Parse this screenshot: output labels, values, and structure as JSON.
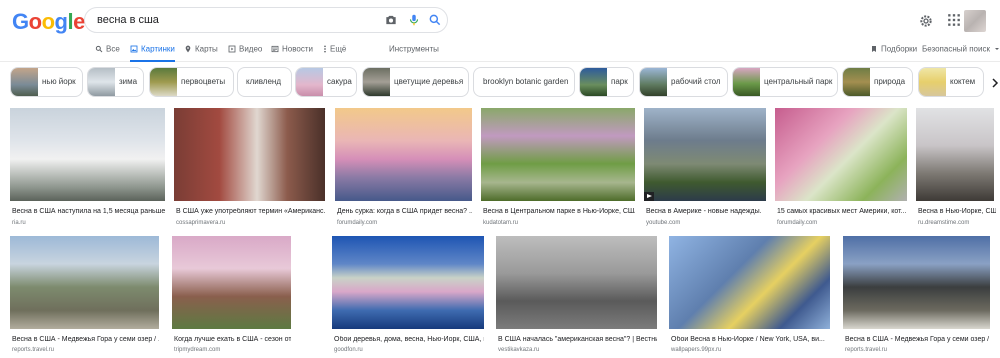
{
  "logo": "Google",
  "search": {
    "query": "весна в сша"
  },
  "tabs": {
    "all": "Все",
    "images": "Картинки",
    "maps": "Карты",
    "video": "Видео",
    "news": "Новости",
    "more": "Ещё",
    "tools": "Инструменты",
    "collections": "Подборки",
    "safesearch": "Безопасный поиск"
  },
  "chips": [
    "нью йорк",
    "зима",
    "первоцветы",
    "кливленд",
    "сакура",
    "цветущие деревья",
    "brooklyn botanic garden",
    "парк",
    "рабочий стол",
    "центральный парк",
    "природа",
    "коктем"
  ],
  "row1": [
    {
      "caption": "Весна в США наступила на 1,5 месяца раньше ...",
      "source": "ria.ru"
    },
    {
      "caption": "В США уже употребляют термин «Американс...",
      "source": "cossaprimavera.ru"
    },
    {
      "caption": "День сурка: когда в США придет весна? ...",
      "source": "forumdaily.com"
    },
    {
      "caption": "Весна в Центральном парке в Нью-Йорке, США.",
      "source": "kudatotam.ru"
    },
    {
      "caption": "Весна в Америке - новые надежды.",
      "source": "youtube.com"
    },
    {
      "caption": "15 самых красивых мест Америки, кот...",
      "source": "forumdaily.com"
    },
    {
      "caption": "Весна в Нью-Йорке, США.",
      "source": "ru.dreamstime.com"
    }
  ],
  "row2": [
    {
      "caption": "Весна в США - Медвежья Гора у семи озер / ...",
      "source": "reports.travel.ru"
    },
    {
      "caption": "Когда лучше ехать в США - сезон отдыха в США ...",
      "source": "tripmydream.com"
    },
    {
      "caption": "Обои деревья, дома, весна, Нью-Йорк, США, во...",
      "source": "goodfon.ru"
    },
    {
      "caption": "В США началась \"американская весна\"? | Вестник...",
      "source": "vestikavkaza.ru"
    },
    {
      "caption": "Обои Весна в Нью-Йорке / New York, USA, ви...",
      "source": "wallpapers.99px.ru"
    },
    {
      "caption": "Весна в США - Медвежья Гора у семи озер / ...",
      "source": "reports.travel.ru"
    }
  ]
}
